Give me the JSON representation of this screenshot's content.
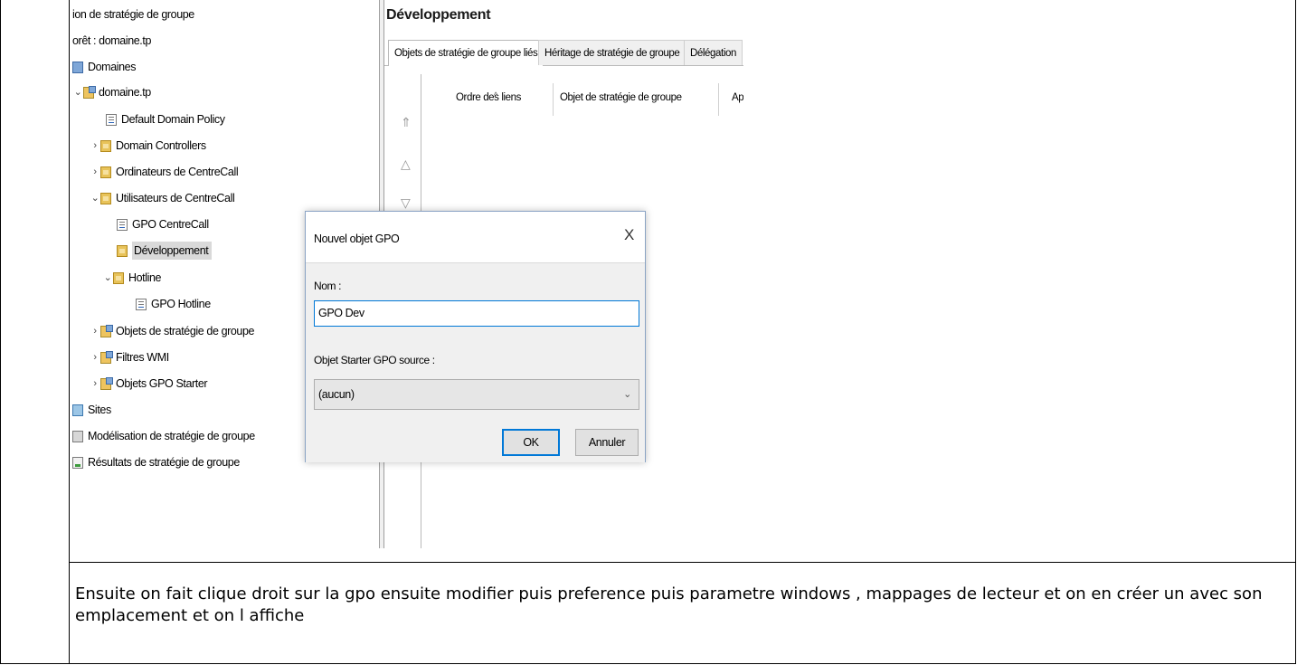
{
  "tree": {
    "items": [
      {
        "label": "ion de stratégie de groupe",
        "chevron": "",
        "icon": "none"
      },
      {
        "label": "orêt : domaine.tp",
        "chevron": "",
        "icon": "none"
      },
      {
        "label": "Domaines",
        "chevron": "",
        "icon": "domain"
      },
      {
        "label": "domaine.tp",
        "chevron": "⌄",
        "icon": "multi"
      },
      {
        "label": "Default Domain Policy",
        "chevron": "",
        "icon": "gpo"
      },
      {
        "label": "Domain Controllers",
        "chevron": "›",
        "icon": "folder"
      },
      {
        "label": "Ordinateurs de CentreCall",
        "chevron": "›",
        "icon": "folder"
      },
      {
        "label": "Utilisateurs de CentreCall",
        "chevron": "⌄",
        "icon": "folder"
      },
      {
        "label": "GPO CentreCall",
        "chevron": "",
        "icon": "gpo"
      },
      {
        "label": "Développement",
        "chevron": "",
        "icon": "folder"
      },
      {
        "label": "Hotline",
        "chevron": "⌄",
        "icon": "folder"
      },
      {
        "label": "GPO Hotline",
        "chevron": "",
        "icon": "gpo"
      },
      {
        "label": "Objets de stratégie de groupe",
        "chevron": "›",
        "icon": "multi"
      },
      {
        "label": "Filtres WMI",
        "chevron": "›",
        "icon": "multi"
      },
      {
        "label": "Objets GPO Starter",
        "chevron": "›",
        "icon": "multi"
      },
      {
        "label": "Sites",
        "chevron": "",
        "icon": "sites"
      },
      {
        "label": "Modélisation de stratégie de groupe",
        "chevron": "",
        "icon": "model"
      },
      {
        "label": "Résultats de stratégie de groupe",
        "chevron": "",
        "icon": "result"
      }
    ]
  },
  "right_pane": {
    "title": "Développement",
    "tabs": [
      "Objets de stratégie de groupe liés",
      "Héritage de stratégie de groupe",
      "Délégation"
    ],
    "columns": [
      "Ordre des liens",
      "Objet de stratégie de groupe",
      "Ap"
    ],
    "sort_caret": "^",
    "move_top": "⇑",
    "move_up": "△",
    "move_down": "▽"
  },
  "dialog": {
    "title": "Nouvel objet GPO",
    "close": "X",
    "name_label": "Nom :",
    "name_value": "GPO Dev",
    "starter_label": "Objet Starter GPO source :",
    "starter_value": "(aucun)",
    "select_chevron": "⌄",
    "ok": "OK",
    "cancel": "Annuler"
  },
  "caption": "Ensuite on fait clique droit sur la gpo ensuite modifier puis preference puis parametre windows , mappages de lecteur et on en créer un avec son emplacement et on l affiche"
}
